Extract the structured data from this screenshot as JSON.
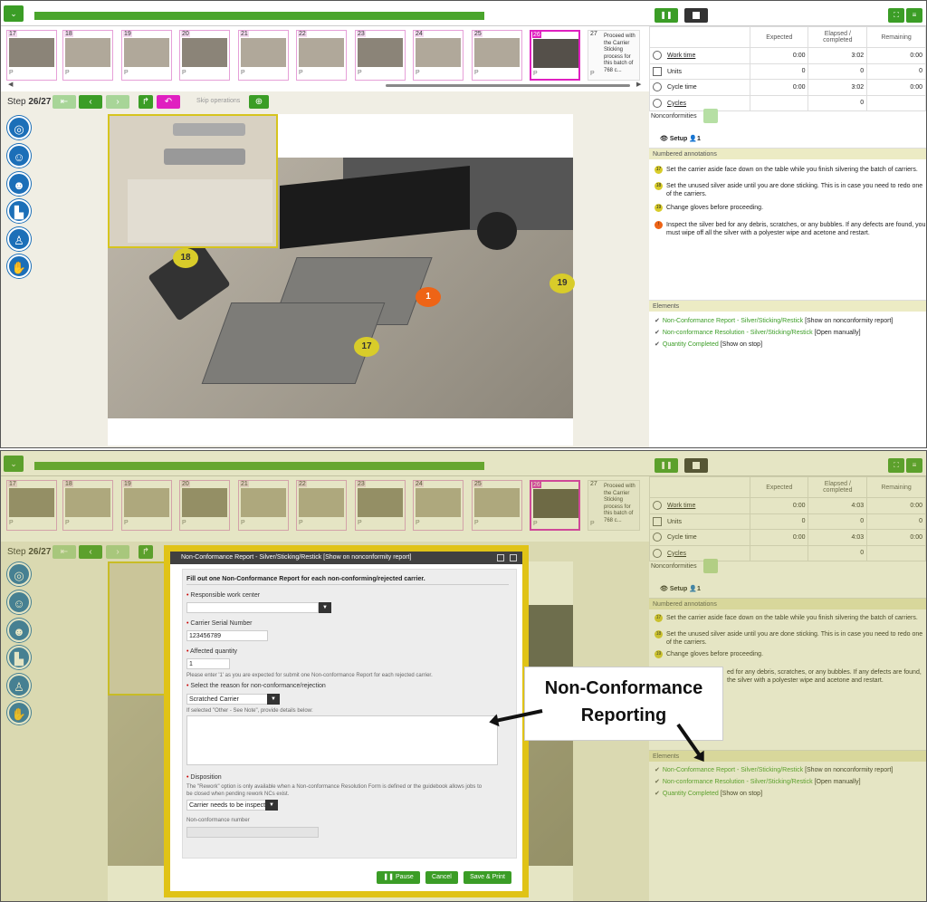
{
  "header": {
    "collapse_icon": "chevron-down-icon",
    "pause_icon": "pause-icon",
    "stop_icon": "stop-icon",
    "fullscreen_icon": "fullscreen-icon",
    "menu_icon": "hamburger-menu-icon",
    "brand_color": "#3b9d26"
  },
  "thumbnails": [
    {
      "num": "17",
      "footer": "P"
    },
    {
      "num": "18",
      "footer": "P"
    },
    {
      "num": "19",
      "footer": "P"
    },
    {
      "num": "20",
      "footer": "P"
    },
    {
      "num": "21",
      "footer": "P"
    },
    {
      "num": "22",
      "footer": "P"
    },
    {
      "num": "23",
      "footer": "P"
    },
    {
      "num": "24",
      "footer": "P"
    },
    {
      "num": "25",
      "footer": "P"
    },
    {
      "num": "26",
      "footer": "P"
    }
  ],
  "next_step": {
    "num": "27",
    "text": "Proceed with the Carrier Sticking process for this batch of 768 c...",
    "text2": "Proceed with the Carrier Sticking process for this batch of 768 c...",
    "footer": "P"
  },
  "step": {
    "label": "Step",
    "current": "26/27",
    "skip": "Skip operations"
  },
  "ppe": [
    "safety-glasses-icon",
    "hairnet-icon",
    "face-mask-icon",
    "shoe-covers-icon",
    "coverall-icon",
    "gloves-icon"
  ],
  "bubbles": {
    "b18": "18",
    "b1": "1",
    "b19": "19",
    "b17": "17"
  },
  "stats": {
    "headers": [
      "Expected",
      "Elapsed / completed",
      "Remaining"
    ],
    "p1": [
      {
        "label": "Work time",
        "expected": "0:00",
        "elapsed": "3:02",
        "remaining": "0:00"
      },
      {
        "label": "Units",
        "expected": "0",
        "elapsed": "0",
        "remaining": "0"
      },
      {
        "label": "Cycle time",
        "expected": "0:00",
        "elapsed": "3:02",
        "remaining": "0:00"
      },
      {
        "label": "Cycles",
        "expected": "",
        "elapsed": "0",
        "remaining": ""
      }
    ],
    "p2": [
      {
        "label": "Work time",
        "expected": "0:00",
        "elapsed": "4:03",
        "remaining": "0:00"
      },
      {
        "label": "Units",
        "expected": "0",
        "elapsed": "0",
        "remaining": "0"
      },
      {
        "label": "Cycle time",
        "expected": "0:00",
        "elapsed": "4:03",
        "remaining": "0:00"
      },
      {
        "label": "Cycles",
        "expected": "",
        "elapsed": "0",
        "remaining": ""
      }
    ]
  },
  "nonconformities": "Nonconformities",
  "setup": {
    "label": "Setup",
    "users": "1"
  },
  "annotations": {
    "title": "Numbered annotations",
    "items": [
      {
        "marker": "17",
        "text": "Set the carrier aside face down on the table while you finish silvering the batch of carriers."
      },
      {
        "marker": "18",
        "text": "Set the unused silver aside until you are done sticking. This is in case you need to redo one of the carriers."
      },
      {
        "marker": "19",
        "text": "Change gloves before proceeding."
      },
      {
        "marker": "!",
        "text": "Inspect the silver bed for any debris, scratches, or any bubbles. If any defects are found, you must wipe off all the silver with a polyester wipe and acetone and restart."
      }
    ],
    "partial": "ed for any debris, scratches, or any bubbles. If any defects are found, the silver with a polyester wipe and acetone and restart."
  },
  "elements": {
    "title": "Elements",
    "items": [
      {
        "name": "Non-Conformance Report - Silver/Sticking/Restick",
        "note": "[Show on nonconformity report]"
      },
      {
        "name": "Non-conformance Resolution - Silver/Sticking/Restick",
        "note": "[Open manually]"
      },
      {
        "name": "Quantity Completed",
        "note": "[Show on stop]"
      }
    ]
  },
  "dialog": {
    "title": "Non-Conformance Report - Silver/Sticking/Restick [Show on nonconformity report]",
    "intro": "Fill out one Non-Conformance Report for each non-conforming/rejected carrier.",
    "work_center_label": "Responsible work center",
    "serial_label": "Carrier Serial Number",
    "serial_value": "123456789",
    "qty_label": "Affected quantity",
    "qty_value": "1",
    "qty_hint": "Please enter '1' as you are expected for submit one Non-conformance Report for each rejected carrier.",
    "reason_label": "Select the reason for non-conformance/rejection",
    "reason_value": "Scratched Carrier",
    "other_label": "If selected \"Other - See Note\", provide details below:",
    "disposition_label": "Disposition",
    "disposition_hint": "The \"Rework\" option is only available when a Non-conformance Resolution Form is defined or the guidebook allows jobs to be closed when pending rework NCs exist.",
    "disposition_value": "Carrier needs to be inspecte",
    "nc_number_label": "Non-conformance number",
    "pause": "Pause",
    "cancel": "Cancel",
    "save": "Save & Print"
  },
  "callout": {
    "line1": "Non-Conformance",
    "line2": "Reporting"
  }
}
